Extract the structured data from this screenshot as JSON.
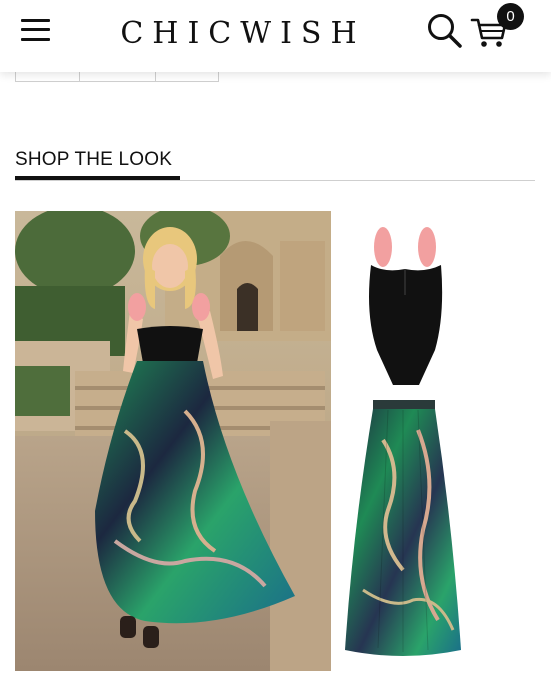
{
  "header": {
    "logo": "CHICWISH",
    "cart_count": "0",
    "icons": {
      "menu": "hamburger-menu-icon",
      "search": "search-icon",
      "cart": "cart-icon"
    }
  },
  "section": {
    "title": "SHOP THE LOOK"
  },
  "colors": {
    "text": "#111111",
    "divider": "#cfcfcf",
    "swimsuit": "#111111",
    "ruffle": "#f2a0a0",
    "skirt_green": "#1f8a55",
    "skirt_navy": "#1c2840"
  },
  "products": [
    {
      "name": "black-swimsuit-pink-ruffle-straps"
    },
    {
      "name": "green-paisley-maxi-skirt"
    }
  ]
}
